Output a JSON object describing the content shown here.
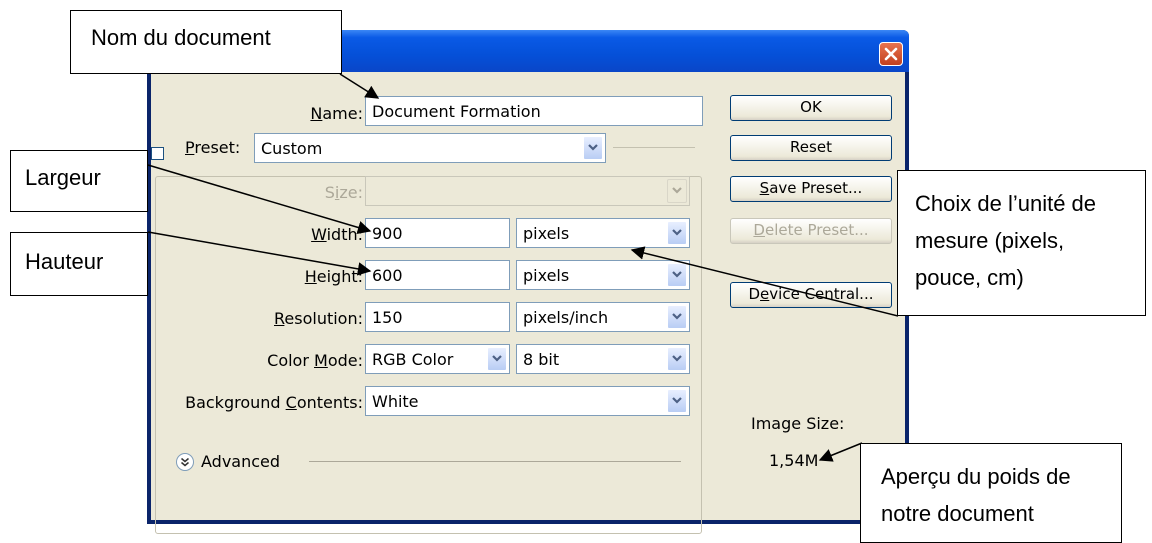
{
  "dialog": {
    "fields": {
      "name": {
        "label_pre": "",
        "label_u": "N",
        "label_post": "ame:",
        "value": "Document Formation"
      },
      "preset": {
        "label_pre": "",
        "label_u": "P",
        "label_post": "reset:",
        "value": "Custom"
      },
      "size": {
        "label_pre": "S",
        "label_u": "i",
        "label_post": "ze:",
        "value": ""
      },
      "width": {
        "label_pre": "",
        "label_u": "W",
        "label_post": "idth:",
        "value": "900",
        "unit": "pixels"
      },
      "height": {
        "label_pre": "",
        "label_u": "H",
        "label_post": "eight:",
        "value": "600",
        "unit": "pixels"
      },
      "resolution": {
        "label_pre": "",
        "label_u": "R",
        "label_post": "esolution:",
        "value": "150",
        "unit": "pixels/inch"
      },
      "color_mode": {
        "label_pre": "Color ",
        "label_u": "M",
        "label_post": "ode:",
        "value": "RGB Color",
        "depth": "8 bit"
      },
      "background": {
        "label_pre": "Background ",
        "label_u": "C",
        "label_post": "ontents:",
        "value": "White"
      }
    },
    "advanced_label": "Advanced",
    "buttons": {
      "ok": {
        "pre": "OK",
        "u": "",
        "post": ""
      },
      "reset": {
        "pre": "Reset",
        "u": "",
        "post": ""
      },
      "save_preset": {
        "pre": "",
        "u": "S",
        "post": "ave Preset..."
      },
      "delete_preset": {
        "pre": "",
        "u": "D",
        "post": "elete Preset..."
      },
      "device_central": {
        "pre": "D",
        "u": "e",
        "post": "vice Central..."
      }
    },
    "image_size_label": "Image Size:",
    "image_size_value": "1,54M"
  },
  "annotations": {
    "nom": "Nom du document",
    "largeur": "Largeur",
    "hauteur": "Hauteur",
    "unite": [
      "Choix de l’unité de",
      "mesure (pixels,",
      "pouce, cm)"
    ],
    "apercu": [
      "Aperçu du poids de",
      "notre document"
    ]
  },
  "colors": {
    "titlebar": "#0a5ae6",
    "dialog_bg": "#ece9d8",
    "close_button": "#d8582e"
  },
  "icons": [
    "close-icon",
    "dropdown-arrow-icon",
    "advanced-expand-icon"
  ]
}
